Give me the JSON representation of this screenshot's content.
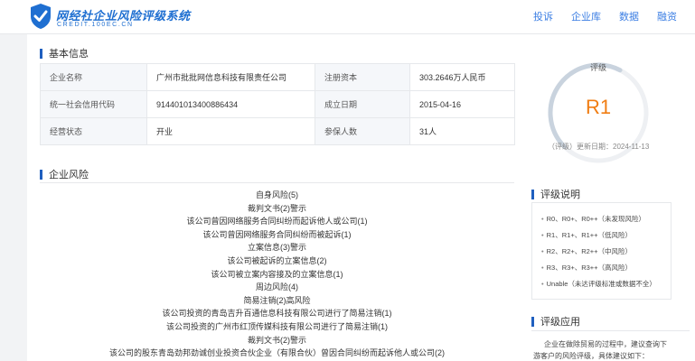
{
  "header": {
    "logo_title": "网经社企业风险评级系统",
    "logo_sub": "CREDIT.100EC.CN",
    "nav": [
      "投诉",
      "企业库",
      "数据",
      "融资"
    ]
  },
  "basic_info": {
    "title": "基本信息",
    "rows": [
      [
        {
          "k": "企业名称",
          "v": "广州市批批网信息科技有限责任公司"
        },
        {
          "k": "注册资本",
          "v": "303.2646万人民币"
        }
      ],
      [
        {
          "k": "统一社会信用代码",
          "v": "914401013400886434"
        },
        {
          "k": "成立日期",
          "v": "2015-04-16"
        }
      ],
      [
        {
          "k": "经营状态",
          "v": "开业"
        },
        {
          "k": "参保人数",
          "v": "31人"
        }
      ]
    ]
  },
  "rating": {
    "label": "评级",
    "value": "R1",
    "update": "（评级）更新日期：2024-11-13",
    "gauge_fraction": 0.45
  },
  "risk": {
    "title": "企业风险",
    "items": [
      "自身风险(5)",
      "裁判文书(2)警示",
      "该公司曾因网络服务合同纠纷而起诉他人或公司(1)",
      "该公司曾因网络服务合同纠纷而被起诉(1)",
      "立案信息(3)警示",
      "该公司被起诉的立案信息(2)",
      "该公司被立案内容接及的立案信息(1)",
      "周边风险(4)",
      "简易注销(2)高风险",
      "该公司投资的青岛吉升百通信息科技有限公司进行了简易注销(1)",
      "该公司投资的广州市红顶传媒科技有限公司进行了简易注销(1)",
      "裁判文书(2)警示",
      "该公司的股东青岛劲邦劲诚创业投资合伙企业（有限合伙）曾因合同纠纷而起诉他人或公司(2)"
    ]
  },
  "rating_desc": {
    "title": "评级说明",
    "items": [
      "R0、R0+、R0++（未发现风险）",
      "R1、R1+、R1++（低风险）",
      "R2、R2+、R2++（中风险）",
      "R3、R3+、R3++（高风险）",
      "Unable（未达评级标准或数据不全）"
    ]
  },
  "rating_app": {
    "title": "评级应用",
    "text": "企业在做除贸易的过程中，建议查询下游客户的风险评级，具体建议如下："
  },
  "colors": {
    "brand_blue": "#1f6fd1",
    "nav_blue": "#3b7ee3",
    "rating_orange": "#f07d13",
    "gauge_track": "#eef0f3",
    "gauge_fill": "#c9d3de"
  }
}
